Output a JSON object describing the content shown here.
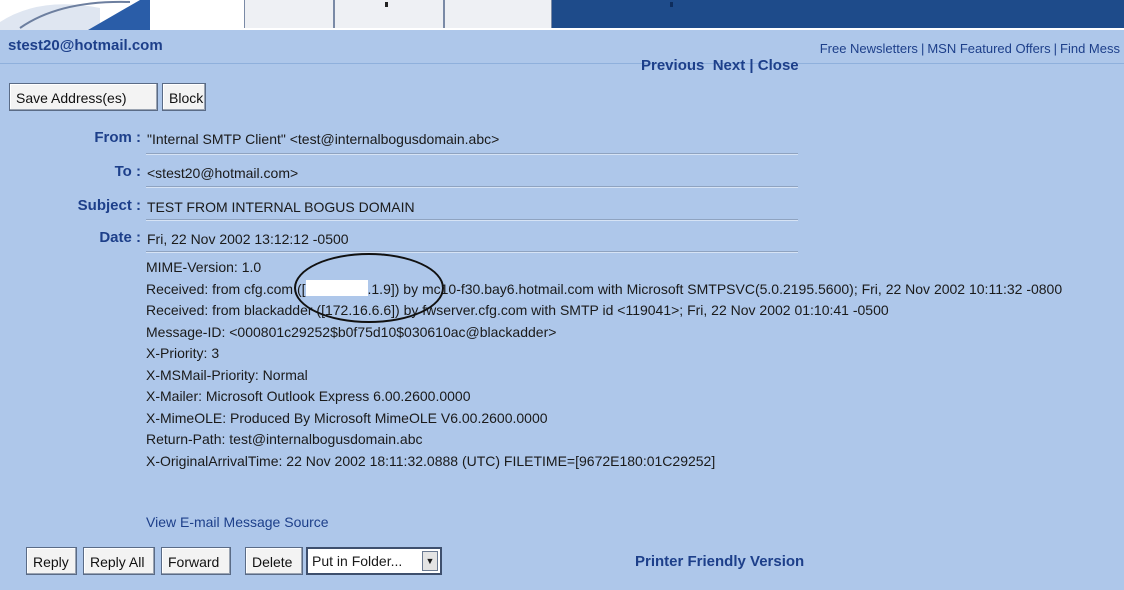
{
  "account": {
    "email": "stest20@hotmail.com"
  },
  "top_links": [
    "Free Newsletters",
    "MSN Featured Offers",
    "Find Mess"
  ],
  "toolbar_top": {
    "save_address": "Save Address(es)",
    "block": "Block",
    "previous": "Previous",
    "next": "Next",
    "separator": "|",
    "close": "Close"
  },
  "headers": {
    "from_label": "From :",
    "from_value": "\"Internal SMTP Client\" <test@internalbogusdomain.abc>",
    "to_label": "To :",
    "to_value": "<stest20@hotmail.com>",
    "subject_label": "Subject :",
    "subject_value": "TEST FROM INTERNAL BOGUS DOMAIN",
    "date_label": "Date :",
    "date_value": "Fri, 22 Nov 2002 13:12:12 -0500"
  },
  "raw_headers": {
    "mime": "MIME-Version: 1.0",
    "received1_pre": "Received: from cfg.com ([",
    "received1_post": ".1.9]) by mc10-f30.bay6.hotmail.com with Microsoft SMTPSVC(5.0.2195.5600); Fri, 22 Nov 2002 10:11:32 -0800",
    "received2": "Received: from blackadder ([172.16.6.6]) by fwserver.cfg.com with SMTP id <119041>; Fri, 22 Nov 2002 01:10:41 -0500",
    "message_id": "Message-ID: <000801c29252$b0f75d10$030610ac@blackadder>",
    "priority": "X-Priority: 3",
    "msmail_priority": "X-MSMail-Priority: Normal",
    "mailer": "X-Mailer: Microsoft Outlook Express 6.00.2600.0000",
    "mimeole": "X-MimeOLE: Produced By Microsoft MimeOLE V6.00.2600.0000",
    "return_path": "Return-Path: test@internalbogusdomain.abc",
    "arrival_time": "X-OriginalArrivalTime: 22 Nov 2002 18:11:32.0888 (UTC) FILETIME=[9672E180:01C29252]"
  },
  "view_source": "View E-mail Message Source",
  "toolbar_bottom": {
    "reply": "Reply",
    "reply_all": "Reply All",
    "forward": "Forward",
    "delete": "Delete",
    "folder_select": "Put in Folder...",
    "printer_friendly": "Printer Friendly Version"
  },
  "colors": {
    "panel": "#aec7ea",
    "link": "#1d3f8a",
    "tab_dark": "#1e4b8a"
  }
}
